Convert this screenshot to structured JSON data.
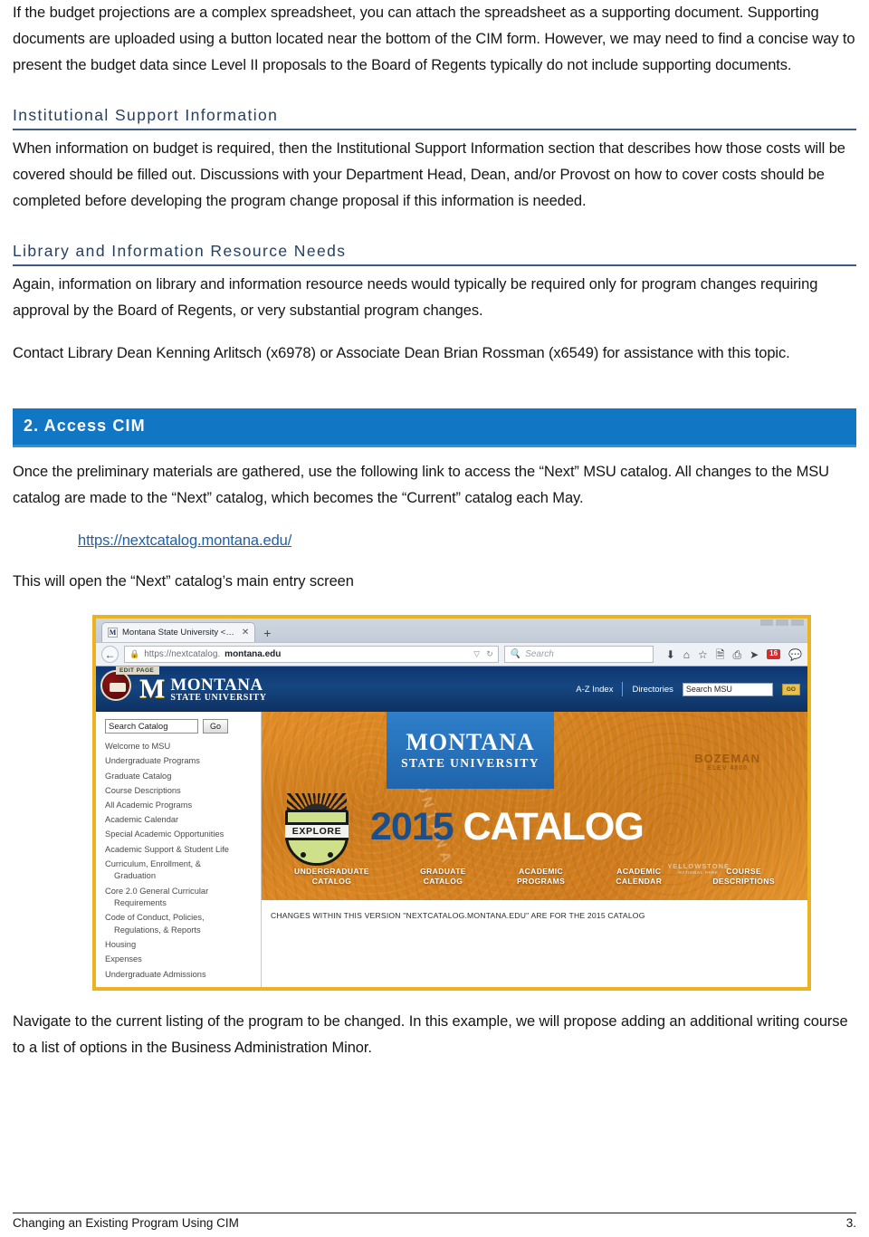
{
  "intro_paragraph": "If the budget projections are a complex spreadsheet, you can attach the spreadsheet as a supporting document. Supporting documents are uploaded using a button located near the bottom of the CIM form. However, we may need to find a concise way to present the budget data since Level II proposals to the Board of Regents typically do not include supporting documents.",
  "sections": [
    {
      "heading": "Institutional Support Information",
      "paragraph": "When information on budget is required, then the Institutional Support Information section that describes how those costs will be covered should be filled out. Discussions with your Department Head, Dean, and/or Provost on how to cover costs should be completed before developing the program change proposal if this information is needed."
    },
    {
      "heading": "Library and Information Resource Needs",
      "paragraph": "Again, information on library and information resource needs would typically be required only for program changes requiring approval by the Board of Regents, or very substantial program changes.",
      "paragraph2": "Contact Library Dean Kenning Arlitsch (x6978) or Associate Dean Brian Rossman (x6549) for assistance with this topic."
    }
  ],
  "access_cim": {
    "banner_label": "2. Access CIM",
    "banner_color": "#1177c4",
    "paragraph": "Once the preliminary materials are gathered, use the following link to access the “Next” MSU catalog. All changes to the MSU catalog are made to the “Next” catalog, which becomes the “Current” catalog each May.",
    "link_text": "https://nextcatalog.montana.edu/",
    "link_color": "#1f5fa9",
    "caption": "This will open the “Next” catalog’s main entry screen"
  },
  "screenshot": {
    "border_color": "#ecb21f",
    "browser": {
      "tab_title": "Montana State University <…",
      "tab_close_icon": "close-icon",
      "favicon_letter": "M",
      "new_tab_icon": "+",
      "back_icon": "←",
      "lock_icon": "🔒",
      "url_prefix": "https://nextcatalog.",
      "url_host": "montana.edu",
      "url_dropdown_icon": "▽",
      "reload_icon": "↻",
      "search_placeholder": "Search",
      "search_icon": "search-icon",
      "toolbar_icons": [
        "download-icon",
        "home-icon",
        "bookmark-star-icon",
        "reader-list-icon",
        "sync-icon",
        "send-tab-icon",
        "badge-icon",
        "chat-icon"
      ],
      "badge_text": "16"
    },
    "msu_header": {
      "edit_page_label": "EDIT PAGE",
      "logo_letter": "M",
      "wordmark_line1": "MONTANA",
      "wordmark_line2": "STATE UNIVERSITY",
      "links": [
        "A-Z Index",
        "Directories"
      ],
      "search_value": "Search MSU",
      "go_label": "GO",
      "bar_color": "#16467f"
    },
    "sidebar": {
      "search_value": "Search Catalog",
      "go_label": "Go",
      "items": [
        "Welcome to MSU",
        "Undergraduate Programs",
        "Graduate Catalog",
        "Course Descriptions",
        "All Academic Programs",
        "Academic Calendar",
        "Special Academic Opportunities",
        "Academic Support & Student Life",
        "Curriculum, Enrollment, &",
        "Graduation",
        "Core 2.0 General Curricular",
        "Requirements",
        "Code of Conduct, Policies,",
        "Regulations, & Reports",
        "Housing",
        "Expenses",
        "Undergraduate Admissions"
      ]
    },
    "catalog_banner": {
      "msu_block_line1": "MONTANA",
      "msu_block_line2": "STATE UNIVERSITY",
      "year": "2015",
      "word": "CATALOG",
      "explore_label": "EXPLORE",
      "bozeman_line1": "BOZEMAN",
      "bozeman_line2": "ELEV 4800",
      "watermark": "MONTANA",
      "yellowstone_line1": "YELLOWSTONE",
      "yellowstone_line2": "NATIONAL PARK",
      "nav": [
        [
          "UNDERGRADUATE",
          "CATALOG"
        ],
        [
          "GRADUATE",
          "CATALOG"
        ],
        [
          "ACADEMIC",
          "PROGRAMS"
        ],
        [
          "ACADEMIC",
          "CALENDAR"
        ],
        [
          "COURSE",
          "DESCRIPTIONS"
        ]
      ],
      "bg_color": "#d98420"
    },
    "note": "CHANGES WITHIN THIS VERSION \"NEXTCATALOG.MONTANA.EDU\" ARE FOR THE 2015 CATALOG"
  },
  "closing_paragraph": "Navigate to the current listing of the program to be changed. In this example, we will propose adding an additional writing course to a list of options in the Business Administration Minor.",
  "footer": {
    "title": "Changing an Existing Program Using CIM",
    "page_number": "3."
  }
}
